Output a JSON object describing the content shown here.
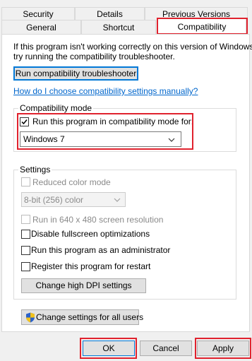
{
  "tabs_row1": [
    "Security",
    "Details",
    "Previous Versions"
  ],
  "tabs_row2": [
    "General",
    "Shortcut",
    "Compatibility"
  ],
  "intro": {
    "line1": "If this program isn't working correctly on this version of Windows,",
    "line2": "try running the compatibility troubleshooter."
  },
  "troubleshooter_button": "Run compatibility troubleshooter",
  "manual_link": "How do I choose compatibility settings manually?",
  "compat_mode": {
    "title": "Compatibility mode",
    "checkbox_label": "Run this program in compatibility mode for:",
    "checked": true,
    "selected_os": "Windows 7"
  },
  "settings": {
    "title": "Settings",
    "reduced_color": "Reduced color mode",
    "color_depth": "8-bit (256) color",
    "run_640": "Run in 640 x 480 screen resolution",
    "disable_fullscreen": "Disable fullscreen optimizations",
    "run_admin": "Run this program as an administrator",
    "register_restart": "Register this program for restart",
    "dpi_button": "Change high DPI settings"
  },
  "all_users_button": "Change settings for all users",
  "footer": {
    "ok": "OK",
    "cancel": "Cancel",
    "apply": "Apply"
  },
  "colors": {
    "highlight_red": "#e0222e",
    "link_blue": "#0066cc",
    "button_focus_blue": "#0078d7"
  }
}
